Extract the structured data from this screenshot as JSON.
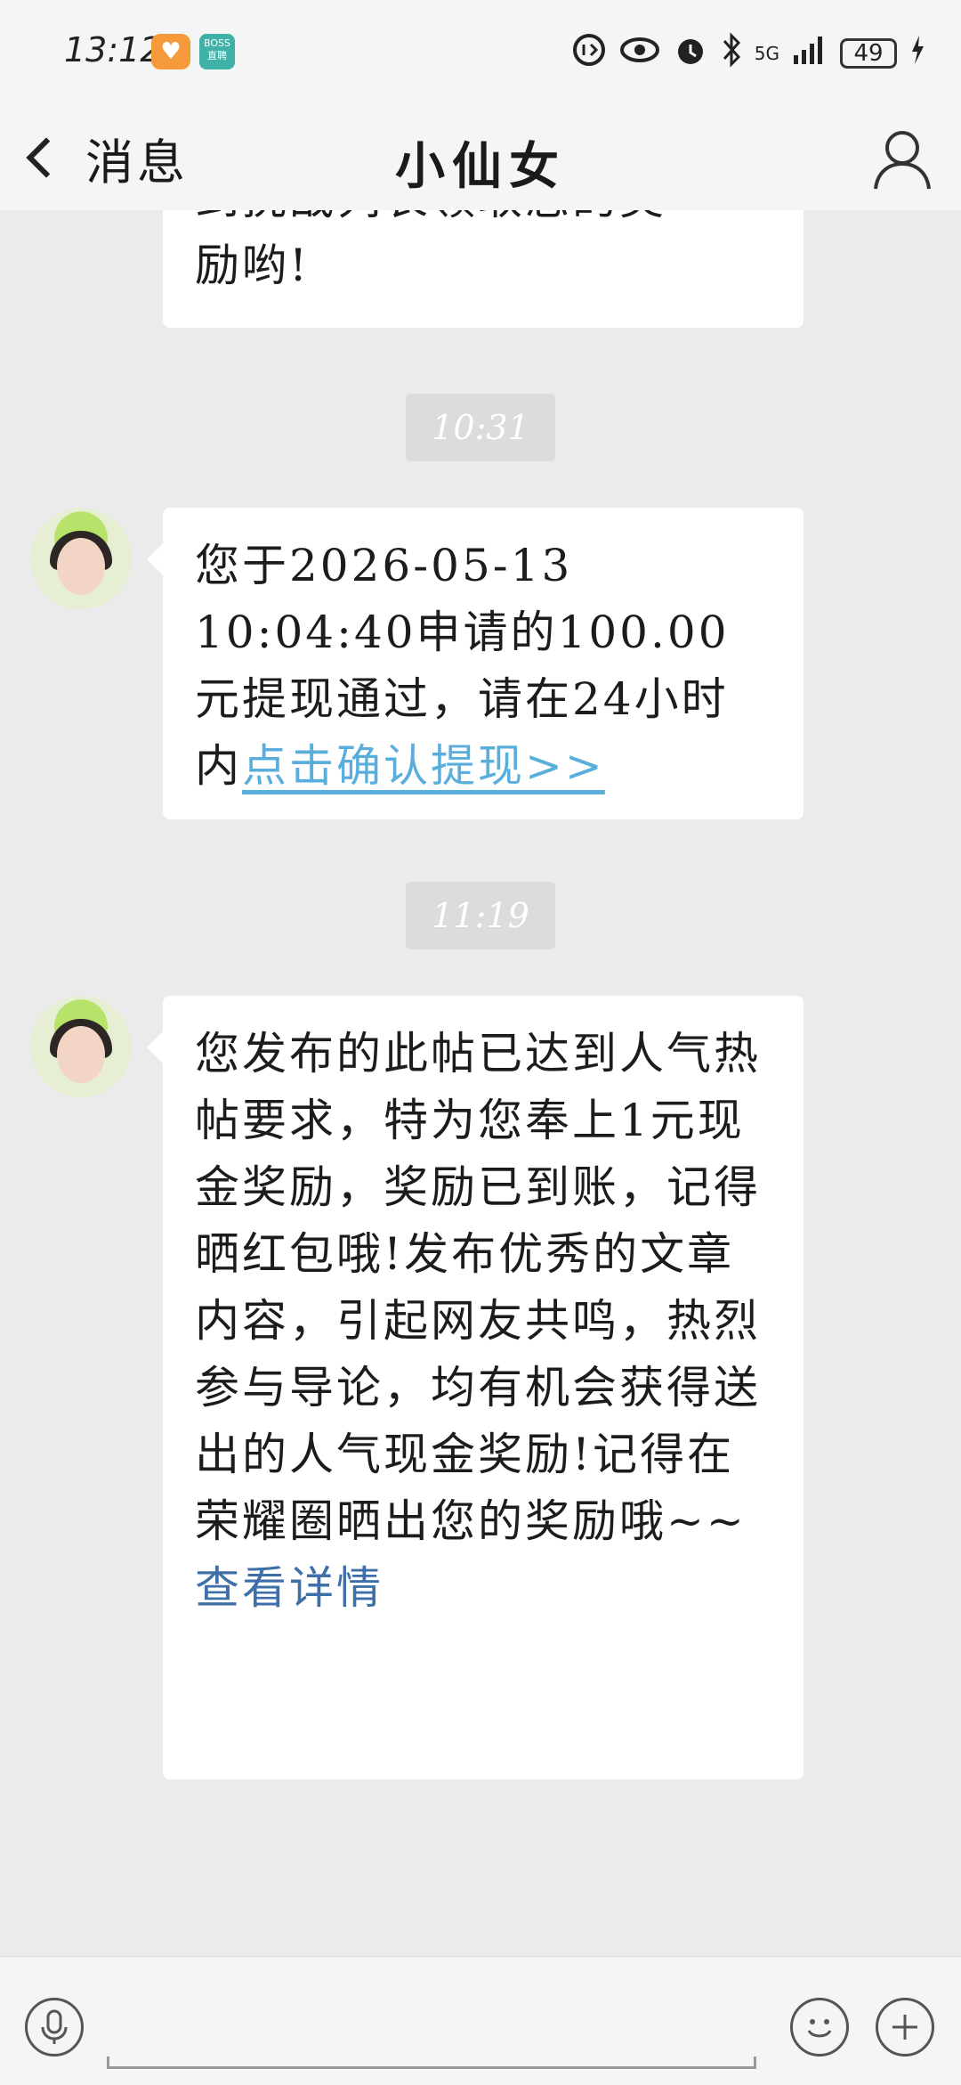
{
  "status_bar": {
    "time": "13:12",
    "network": "5G",
    "battery": "49"
  },
  "header": {
    "back_label": "消息",
    "title": "小仙女"
  },
  "messages": [
    {
      "text_visible_line1": "到挑战列表领取您的奖",
      "text_visible_line2": "励哟!"
    },
    {
      "timestamp": "10:31",
      "text_part1": "您于2026-05-13 10:04:40申请的100.00元提现通过，请在24小时内",
      "link_text": "点击确认提现>>"
    },
    {
      "timestamp": "11:19",
      "body": "您发布的此帖已达到人气热帖要求，特为您奉上1元现金奖励，奖励已到账，记得晒红包哦!发布优秀的文章内容，引起网友共鸣，热烈参与导论，均有机会获得送出的人气现金奖励!记得在荣耀圈晒出您的奖励哦~~",
      "link_text": "查看详情"
    }
  ],
  "colors": {
    "link_blue": "#5aaedc",
    "link_dark": "#3f6fa8",
    "chat_bg": "#ebebeb"
  }
}
